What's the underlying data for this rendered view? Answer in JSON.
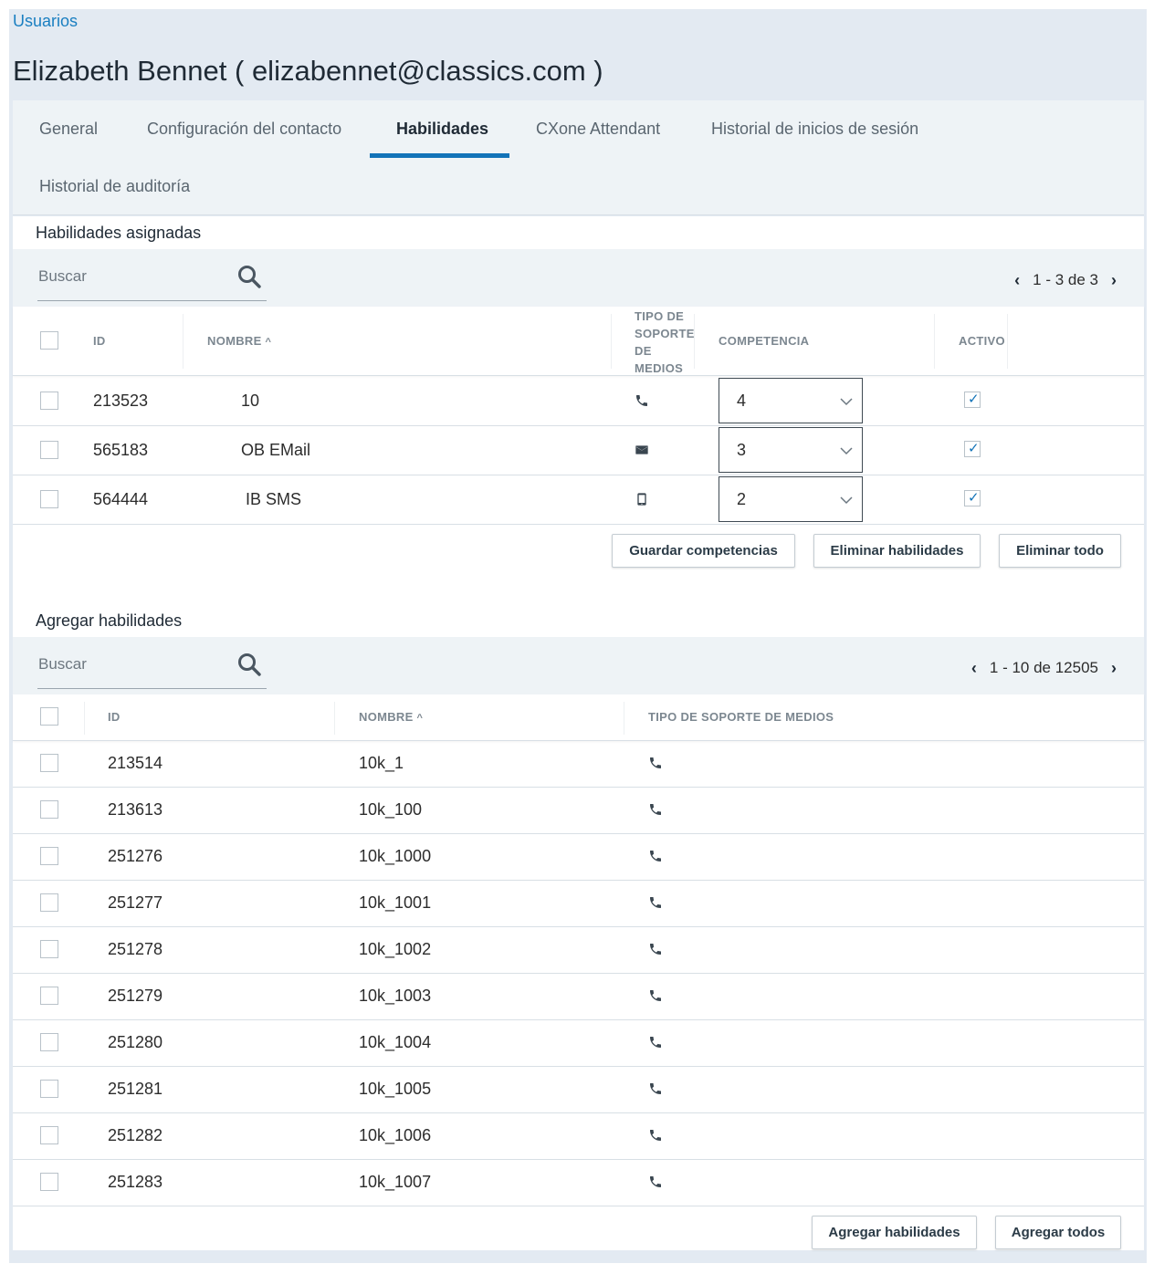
{
  "breadcrumb": "Usuarios",
  "page_title": "Elizabeth Bennet ( elizabennet@classics.com )",
  "tabs": [
    {
      "label": "General"
    },
    {
      "label": "Configuración del contacto"
    },
    {
      "label": "Habilidades"
    },
    {
      "label": "CXone Attendant"
    },
    {
      "label": "Historial de inicios de sesión"
    },
    {
      "label": "Historial de auditoría"
    }
  ],
  "active_tab": "Habilidades",
  "assigned": {
    "title": "Habilidades asignadas",
    "search_placeholder": "Buscar",
    "pager": "1 - 3 de 3",
    "headers": {
      "id": "ID",
      "name": "NOMBRE",
      "media_line1": "TIPO DE",
      "media_line2": "SOPORTE",
      "media_line3": "DE",
      "media_line4": "MEDIOS",
      "proficiency": "COMPETENCIA",
      "active": "ACTIVO"
    },
    "rows": [
      {
        "id": "213523",
        "name": "10",
        "media": "phone-icon",
        "proficiency": "4",
        "active": true
      },
      {
        "id": "565183",
        "name": "OB EMail",
        "media": "email-icon",
        "proficiency": "3",
        "active": true
      },
      {
        "id": "564444",
        "name": "IB SMS",
        "media": "mobile-icon",
        "proficiency": "2",
        "active": true
      }
    ],
    "buttons": {
      "save": "Guardar competencias",
      "remove": "Eliminar habilidades",
      "remove_all": "Eliminar todo"
    }
  },
  "add": {
    "title": "Agregar habilidades",
    "search_placeholder": "Buscar",
    "pager": "1 - 10 de 12505",
    "headers": {
      "id": "ID",
      "name": "NOMBRE",
      "media": "TIPO DE SOPORTE DE MEDIOS"
    },
    "rows": [
      {
        "id": "213514",
        "name": "10k_1",
        "media": "phone-icon"
      },
      {
        "id": "213613",
        "name": "10k_100",
        "media": "phone-icon"
      },
      {
        "id": "251276",
        "name": "10k_1000",
        "media": "phone-icon"
      },
      {
        "id": "251277",
        "name": "10k_1001",
        "media": "phone-icon"
      },
      {
        "id": "251278",
        "name": "10k_1002",
        "media": "phone-icon"
      },
      {
        "id": "251279",
        "name": "10k_1003",
        "media": "phone-icon"
      },
      {
        "id": "251280",
        "name": "10k_1004",
        "media": "phone-icon"
      },
      {
        "id": "251281",
        "name": "10k_1005",
        "media": "phone-icon"
      },
      {
        "id": "251282",
        "name": "10k_1006",
        "media": "phone-icon"
      },
      {
        "id": "251283",
        "name": "10k_1007",
        "media": "phone-icon"
      }
    ],
    "buttons": {
      "add": "Agregar habilidades",
      "add_all": "Agregar todos"
    }
  },
  "colors": {
    "accent": "#1273b8",
    "link": "#1a7fc1",
    "header_bg": "#e3eaf2",
    "toolbar_bg": "#eef3f6"
  }
}
